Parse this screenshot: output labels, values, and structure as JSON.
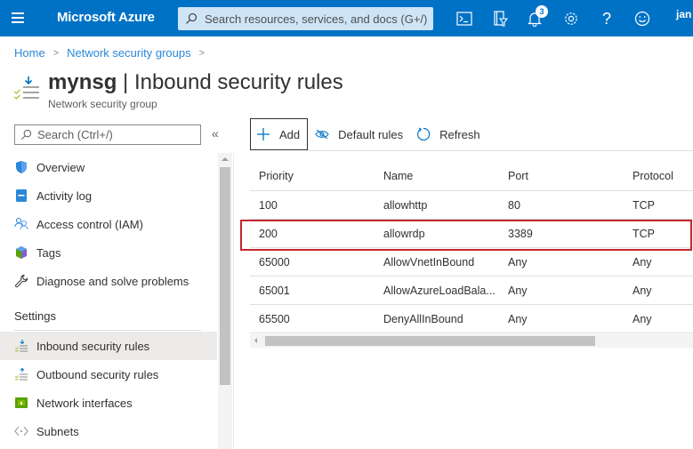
{
  "topbar": {
    "brand": "Microsoft Azure",
    "search_placeholder": "Search resources, services, and docs (G+/)",
    "notification_count": "3",
    "user": "jan",
    "colors": {
      "bar": "#0072c6",
      "search_bg": "#cfe4f5"
    }
  },
  "breadcrumb": {
    "items": [
      "Home",
      "Network security groups"
    ]
  },
  "page": {
    "resource_name": "mynsg",
    "blade_title": "Inbound security rules",
    "separator": "|",
    "subtitle": "Network security group"
  },
  "sidebar": {
    "search_placeholder": "Search (Ctrl+/)",
    "collapse_glyph": "«",
    "items": [
      {
        "label": "Overview",
        "icon": "shield-icon"
      },
      {
        "label": "Activity log",
        "icon": "log-icon"
      },
      {
        "label": "Access control (IAM)",
        "icon": "people-icon"
      },
      {
        "label": "Tags",
        "icon": "tag-icon"
      },
      {
        "label": "Diagnose and solve problems",
        "icon": "wrench-icon"
      }
    ],
    "section_label": "Settings",
    "settings_items": [
      {
        "label": "Inbound security rules",
        "icon": "inbound-rules-icon",
        "active": true
      },
      {
        "label": "Outbound security rules",
        "icon": "outbound-rules-icon"
      },
      {
        "label": "Network interfaces",
        "icon": "nic-icon"
      },
      {
        "label": "Subnets",
        "icon": "subnet-icon"
      }
    ]
  },
  "toolbar": {
    "add_label": "Add",
    "default_rules_label": "Default rules",
    "refresh_label": "Refresh"
  },
  "table": {
    "columns": [
      "Priority",
      "Name",
      "Port",
      "Protocol"
    ],
    "rows": [
      {
        "priority": "100",
        "name": "allowhttp",
        "port": "80",
        "protocol": "TCP"
      },
      {
        "priority": "200",
        "name": "allowrdp",
        "port": "3389",
        "protocol": "TCP",
        "highlighted": true
      },
      {
        "priority": "65000",
        "name": "AllowVnetInBound",
        "port": "Any",
        "protocol": "Any"
      },
      {
        "priority": "65001",
        "name": "AllowAzureLoadBala...",
        "port": "Any",
        "protocol": "Any"
      },
      {
        "priority": "65500",
        "name": "DenyAllInBound",
        "port": "Any",
        "protocol": "Any"
      }
    ],
    "highlight_color": "#c4262e"
  }
}
